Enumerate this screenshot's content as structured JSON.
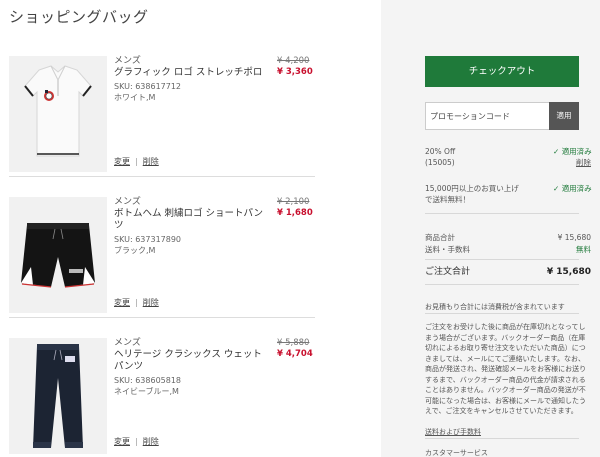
{
  "page": {
    "title": "ショッピングバッグ"
  },
  "cart": {
    "items": [
      {
        "gender": "メンズ",
        "name": "グラフィック ロゴ ストレッチポロ",
        "orig_price": "¥ 4,200",
        "sale_price": "¥ 3,360",
        "sku": "SKU: 638617712",
        "variant": "ホワイト,M",
        "edit": "変更",
        "delete": "削除"
      },
      {
        "gender": "メンズ",
        "name": "ボトムヘム 刺繍ロゴ ショートパンツ",
        "orig_price": "¥ 2,100",
        "sale_price": "¥ 1,680",
        "sku": "SKU: 637317890",
        "variant": "ブラック,M",
        "edit": "変更",
        "delete": "削除"
      },
      {
        "gender": "メンズ",
        "name": "ヘリテージ クラシックス ウェットパンツ",
        "orig_price": "¥ 5,880",
        "sale_price": "¥ 4,704",
        "sku": "SKU: 638605818",
        "variant": "ネイビーブルー,M",
        "edit": "変更",
        "delete": "削除"
      }
    ]
  },
  "summary": {
    "checkout_label": "チェックアウト",
    "promo_placeholder": "プロモーションコード",
    "apply_label": "適用",
    "discount_line1": "20% Off",
    "discount_line2": "(15005)",
    "discount_status": "適用済み",
    "discount_remove": "削除",
    "shipping_line1": "15,000円以上のお買い上げ",
    "shipping_line2": "で送料無料！",
    "shipping_status": "適用済み",
    "subtotal_label": "商品合計",
    "subtotal_value": "¥ 15,680",
    "shipping_fee_label": "送料・手数料",
    "shipping_fee_value": "無料",
    "total_label": "ご注文合計",
    "total_value": "¥ 15,680",
    "tax_note": "お見積もり合計には消費税が含まれています",
    "backorder_note": "ご注文をお受けした後に商品が在庫切れとなってしまう場合がございます。バックオーダー商品（在庫切れによるお取り寄せ注文をいただいた商品）につきましては、メールにてご連絡いたします。なお、商品が発送され、発送確認メールをお客様にお送りするまで、バックオーダー商品の代金が請求されることはありません。バックオーダー商品の発送が不可能になった場合は、お客様にメールで通知したうえで、ご注文をキャンセルさせていただきます。",
    "shipping_link": "送料および手数料",
    "customer_service": "カスタマーサービス"
  },
  "colors": {
    "accent_green": "#1f7a3a",
    "sale_red": "#c8102e"
  }
}
